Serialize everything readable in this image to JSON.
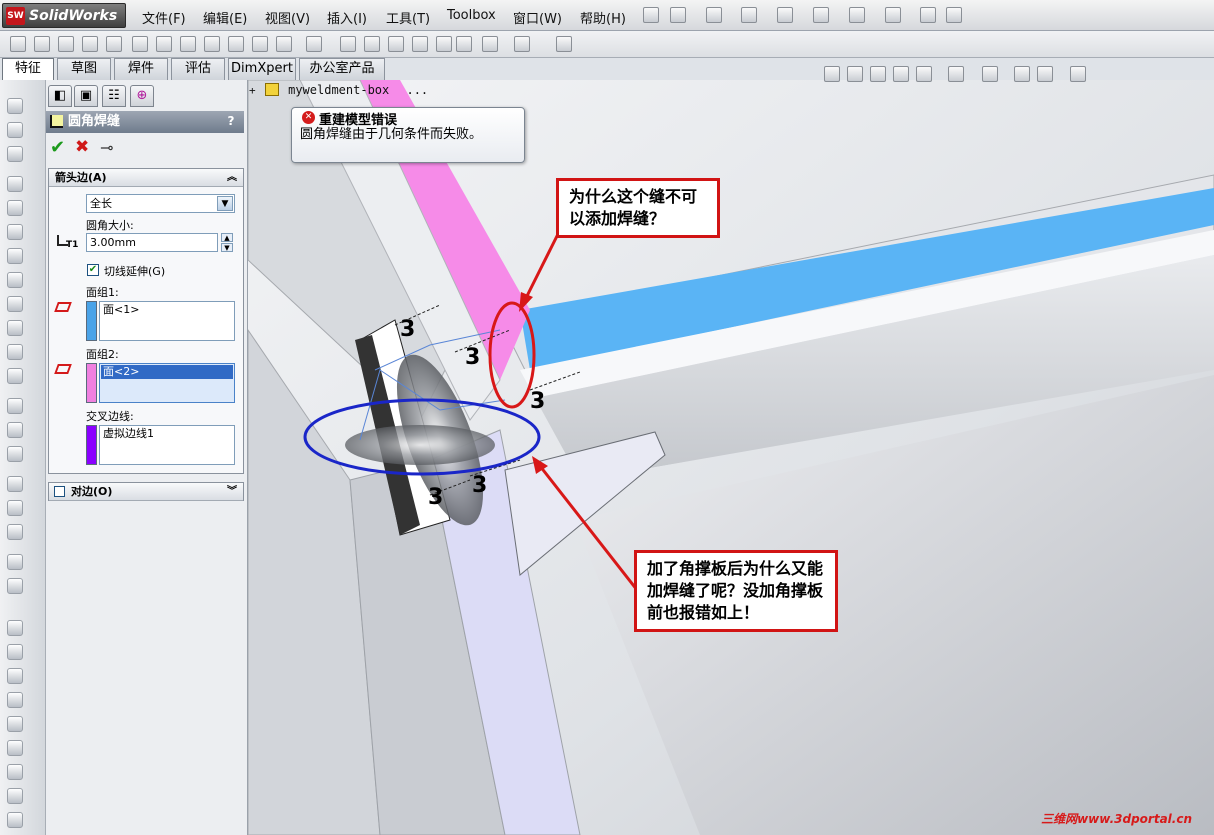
{
  "app": {
    "logo": "SolidWorks",
    "logo_badge": "SW"
  },
  "menu": [
    "文件(F)",
    "编辑(E)",
    "视图(V)",
    "插入(I)",
    "工具(T)",
    "Toolbox",
    "窗口(W)",
    "帮助(H)"
  ],
  "cm_tabs": [
    "特征",
    "草图",
    "焊件",
    "评估",
    "DimXpert",
    "办公室产品"
  ],
  "pm": {
    "title": "圆角焊缝",
    "help": "?",
    "ok": "✔",
    "cancel": "✖",
    "pin": "⊸",
    "arrow_side": {
      "header": "箭头边(A)",
      "type_value": "全长",
      "size_label": "圆角大小:",
      "size_value": "3.00mm",
      "tangent_label": "切线延伸(G)",
      "face1_label": "面组1:",
      "face1_value": "面<1>",
      "face2_label": "面组2:",
      "face2_value": "面<2>",
      "edge_label": "交叉边线:",
      "edge_value": "虚拟边线1",
      "size_icon_label": "T1"
    },
    "other_side": {
      "header": "对边(O)"
    }
  },
  "tree": {
    "item": "myweldment-box",
    "ellipsis": "...",
    "expand": "+"
  },
  "error_tip": {
    "title": "重建模型错误",
    "body": "圆角焊缝由于几何条件而失败。"
  },
  "weld_symbols": [
    "3",
    "3",
    "3",
    "3",
    "3"
  ],
  "callouts": {
    "q1": "为什么这个缝不可以添加焊缝？",
    "q2": "加了角撑板后为什么又能加焊缝了呢？没加角撑板前也报错如上！"
  },
  "watermark": "三维网www.3dportal.cn",
  "colors": {
    "face1": "#4aa3e8",
    "face2": "#f080e0",
    "edge": "#8a00ff",
    "callout_border": "#d11414",
    "highlight_blue": "#5ab4f5",
    "highlight_pink": "#f68be8"
  }
}
